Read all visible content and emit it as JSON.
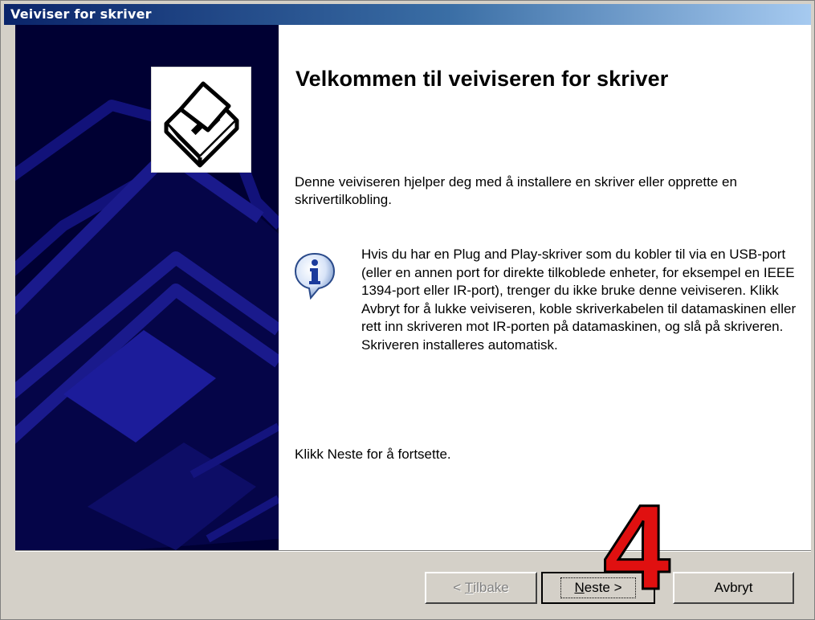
{
  "window": {
    "title": "Veiviser for skriver"
  },
  "content": {
    "heading": "Velkommen til veiviseren for skriver",
    "intro": "Denne veiviseren hjelper deg med å installere en skriver eller opprette en skrivertilkobling.",
    "info_icon": "info-icon",
    "info_text": "Hvis du har en Plug and Play-skriver som du kobler til via en USB-port (eller en annen port for direkte tilkoblede enheter, for eksempel en IEEE 1394-port eller IR-port), trenger du ikke bruke denne veiviseren. Klikk Avbryt for å lukke veiviseren, koble skriverkabelen til datamaskinen eller rett inn skriveren mot IR-porten på datamaskinen, og slå på skriveren. Skriveren installeres automatisk.",
    "continue_text": "Klikk Neste for å fortsette."
  },
  "buttons": {
    "back_prefix": "< ",
    "back_accel": "T",
    "back_rest": "ilbake",
    "next_accel": "N",
    "next_rest": "este >",
    "cancel": "Avbryt"
  },
  "annotation": {
    "step": "4",
    "color": "#e01010"
  },
  "colors": {
    "titlebar_start": "#0a246a",
    "titlebar_end": "#a6caf0",
    "sidepanel": "#000033",
    "dialog_face": "#d4d0c8"
  }
}
